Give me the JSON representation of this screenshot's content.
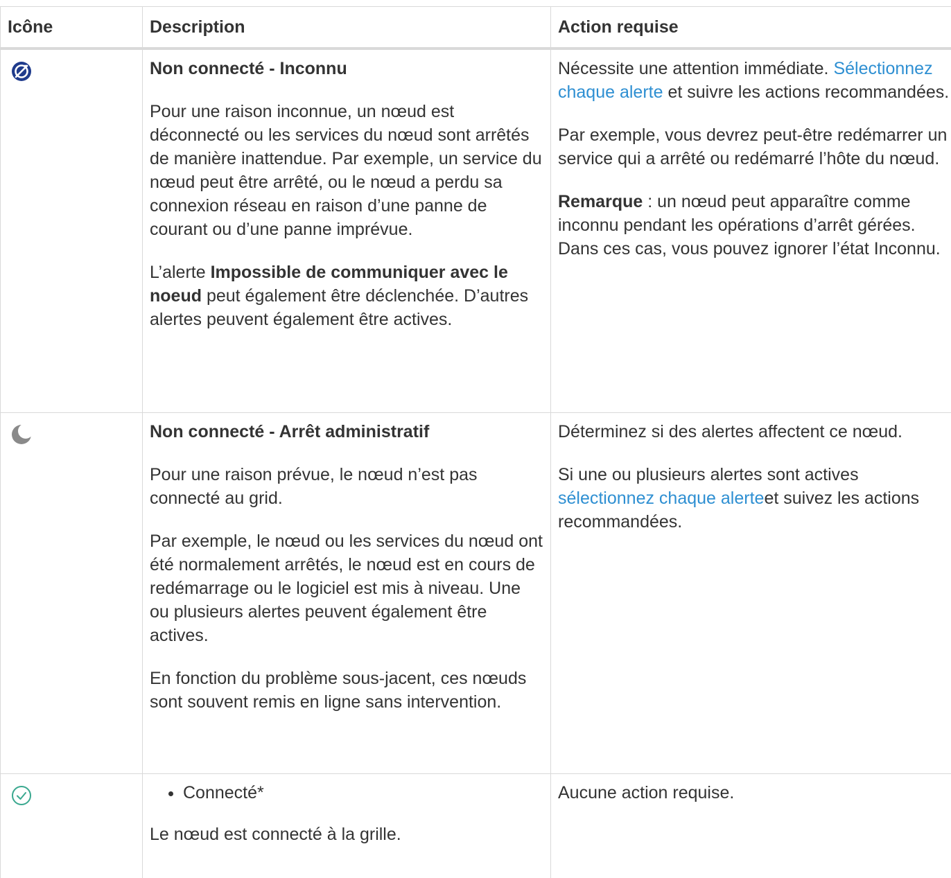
{
  "headers": {
    "icon": "Icône",
    "description": "Description",
    "action": "Action requise"
  },
  "rows": [
    {
      "icon": "unknown-disconnected-icon",
      "icon_color": "#1f3b8c",
      "title": "Non connecté - Inconnu",
      "desc_p1": "Pour une raison inconnue, un nœud est déconnecté ou les services du nœud sont arrêtés de manière inattendue. Par exemple, un service du nœud peut être arrêté, ou le nœud a perdu sa connexion réseau en raison d’une panne de courant ou d’une panne imprévue.",
      "desc_p2_pre": "L’alerte ",
      "desc_p2_bold": "Impossible de communiquer avec le noeud",
      "desc_p2_post": " peut également être déclenchée. D’autres alertes peuvent également être actives.",
      "action_p1_pre": "Nécessite une attention immédiate. ",
      "action_p1_link": "Sélectionnez chaque alerte",
      "action_p1_post": " et suivre les actions recommandées.",
      "action_p2": "Par exemple, vous devrez peut-être redémarrer un service qui a arrêté ou redémarré l’hôte du nœud.",
      "action_p3_bold": "Remarque",
      "action_p3_post": " : un nœud peut apparaître comme inconnu pendant les opérations d’arrêt gérées. Dans ces cas, vous pouvez ignorer l’état Inconnu."
    },
    {
      "icon": "moon-icon",
      "icon_color": "#8a8a8a",
      "title": "Non connecté - Arrêt administratif",
      "desc_p1": "Pour une raison prévue, le nœud n’est pas connecté au grid.",
      "desc_p2": "Par exemple, le nœud ou les services du nœud ont été normalement arrêtés, le nœud est en cours de redémarrage ou le logiciel est mis à niveau. Une ou plusieurs alertes peuvent également être actives.",
      "desc_p3": "En fonction du problème sous-jacent, ces nœuds sont souvent remis en ligne sans intervention.",
      "action_p1": "Déterminez si des alertes affectent ce nœud.",
      "action_p2_pre": "Si une ou plusieurs alertes sont actives ",
      "action_p2_link": "sélectionnez chaque alerte",
      "action_p2_post": "et suivez les actions recommandées."
    },
    {
      "icon": "check-circle-icon",
      "icon_color": "#3aa88f",
      "bullet": "Connecté*",
      "desc_p1": "Le nœud est connecté à la grille.",
      "action_p1": "Aucune action requise."
    }
  ]
}
